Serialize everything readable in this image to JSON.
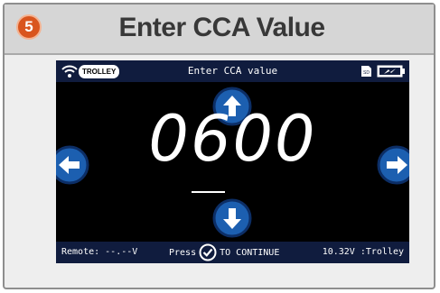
{
  "step": {
    "number": "5",
    "color": "#d9551e"
  },
  "title": "Enter CCA Value",
  "device": {
    "status_bar": {
      "title": "Enter CCA value",
      "mode": "TROLLEY",
      "left_icon": "wifi-icon",
      "right_icons": [
        "sd-card-icon",
        "battery-charging-icon"
      ]
    },
    "cca_value": "0600",
    "cursor_digit_index": 1,
    "arrows": {
      "up": "arrow-up-icon",
      "down": "arrow-down-icon",
      "left": "arrow-left-icon",
      "right": "arrow-right-icon"
    },
    "bottom_bar": {
      "remote": "Remote: --.--V",
      "press": "Press",
      "continue": "TO CONTINUE",
      "voltage": "10.32V :Trolley"
    }
  },
  "colors": {
    "screen_bg": "#000000",
    "bar_bg": "#101c3e",
    "arrow_blue": "#1c5fb0"
  }
}
